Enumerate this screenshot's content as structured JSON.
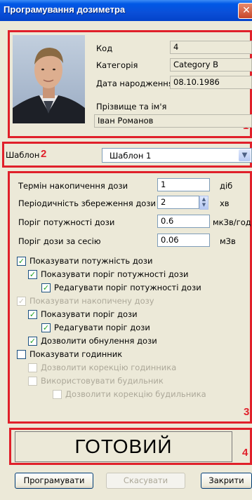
{
  "window": {
    "title": "Програмування дозиметра",
    "close_glyph": "✕"
  },
  "profile": {
    "code_label": "Код",
    "code_value": "4",
    "category_label": "Категорія",
    "category_value": "Category B",
    "dob_label": "Дата народження",
    "dob_value": "08.10.1986",
    "name_label": "Прізвище та ім'я",
    "name_value": "Іван Романов"
  },
  "template": {
    "label": "Шаблон",
    "selected": "Шаблон 1"
  },
  "settings": {
    "accum_term_label": "Термін накопичення дози",
    "accum_term_value": "1",
    "accum_term_unit": "діб",
    "save_period_label": "Періодичність збереження дози",
    "save_period_value": "2",
    "save_period_unit": "хв",
    "rate_threshold_label": "Поріг потужності дози",
    "rate_threshold_value": "0.6",
    "rate_threshold_unit": "мкЗв/год",
    "session_threshold_label": "Поріг дози за сесію",
    "session_threshold_value": "0.06",
    "session_threshold_unit": "мЗв"
  },
  "checkboxes": [
    {
      "label": "Показувати потужність дози",
      "checked": true,
      "enabled": true
    },
    {
      "label": "Показувати поріг потужності дози",
      "checked": true,
      "enabled": true
    },
    {
      "label": "Редагувати поріг потужності дози",
      "checked": true,
      "enabled": true
    },
    {
      "label": "Показувати накопичену дозу",
      "checked": true,
      "enabled": false
    },
    {
      "label": "Показувати поріг дози",
      "checked": true,
      "enabled": true
    },
    {
      "label": "Редагувати поріг дози",
      "checked": true,
      "enabled": true
    },
    {
      "label": "Дозволити обнулення дози",
      "checked": true,
      "enabled": true
    },
    {
      "label": "Показувати годинник",
      "checked": false,
      "enabled": true
    },
    {
      "label": "Дозволити корекцію годинника",
      "checked": false,
      "enabled": false
    },
    {
      "label": "Використовувати будильник",
      "checked": false,
      "enabled": false
    },
    {
      "label": "Дозволити корекцію будильника",
      "checked": false,
      "enabled": false
    }
  ],
  "status_text": "ГОТОВИЙ",
  "buttons": {
    "program": "Програмувати",
    "cancel": "Скасувати",
    "close": "Закрити"
  },
  "annotations": [
    "1",
    "2",
    "3",
    "4"
  ],
  "colors": {
    "annotation": "#e0202a",
    "title_bar": "#0058e6",
    "window_bg": "#ece9d8",
    "check": "#21a121"
  }
}
